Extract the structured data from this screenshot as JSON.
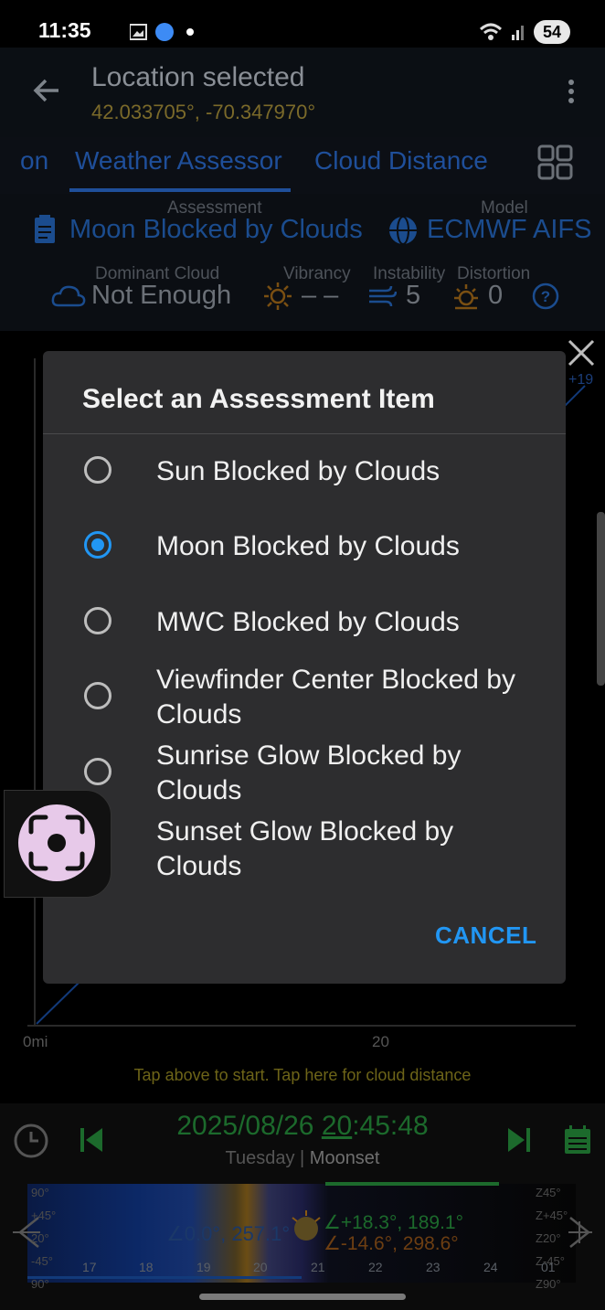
{
  "status_bar": {
    "time": "11:35",
    "battery": "54"
  },
  "app_bar": {
    "title": "Location selected",
    "coords": "42.033705°, -70.347970°"
  },
  "tabs": [
    "on",
    "Weather Assessor",
    "Cloud Distance"
  ],
  "assessment": {
    "assessment_label": "Assessment",
    "assessment_value": "Moon Blocked by Clouds",
    "model_label": "Model",
    "model_value": "ECMWF AIFS",
    "dominant_label": "Dominant Cloud",
    "dominant_value": "Not Enough",
    "vibrancy_label": "Vibrancy",
    "vibrancy_value": "– –",
    "instability_label": "Instability",
    "instability_value": "5",
    "distortion_label": "Distortion",
    "distortion_value": "0"
  },
  "chart": {
    "x_start": "0mi",
    "x_mid": "20",
    "right_label": "+19",
    "hint": "Tap above to start. Tap here for cloud distance"
  },
  "bottom": {
    "date": "2025/08/26",
    "hour": "20",
    "time_rest": ":45:48",
    "day": "Tuesday",
    "sep": "|",
    "event": "Moonset",
    "sun_readout": "∠0.0°, 257.1°",
    "moon_readout_1": "∠+18.3°, 189.1°",
    "moon_readout_2": "∠-14.6°, 298.6°",
    "left_labels": [
      "90°",
      "+45°",
      "20°",
      "-45°",
      "90°"
    ],
    "right_labels": [
      "Z45°",
      "Z+45°",
      "Z20°",
      "Z-45°",
      "Z90°"
    ],
    "hours": [
      "17",
      "18",
      "19",
      "20",
      "21",
      "22",
      "23",
      "24",
      "01"
    ]
  },
  "dialog": {
    "title": "Select an Assessment Item",
    "options": [
      {
        "label": "Sun Blocked by Clouds",
        "selected": false
      },
      {
        "label": "Moon Blocked by Clouds",
        "selected": true
      },
      {
        "label": "MWC Blocked by Clouds",
        "selected": false
      },
      {
        "label": "Viewfinder Center Blocked by Clouds",
        "selected": false
      },
      {
        "label": "Sunrise Glow Blocked by Clouds",
        "selected": false
      },
      {
        "label": "Sunset Glow Blocked by Clouds",
        "selected": false
      }
    ],
    "cancel": "CANCEL"
  },
  "colors": {
    "accent": "#2196f3",
    "dialog_bg": "#2d2d2f",
    "selected_radio": "#2196f3"
  }
}
